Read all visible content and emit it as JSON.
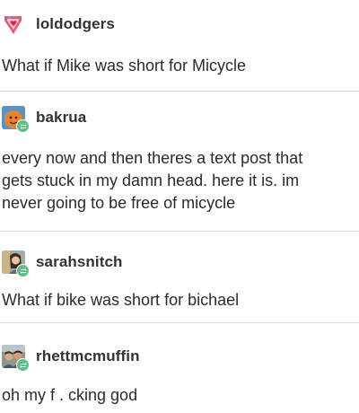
{
  "posts": [
    {
      "username": "loldodgers",
      "lines": [
        "What if Mike was short for Micycle"
      ],
      "avatar_icon": "heart-pennant-icon",
      "reblog": false
    },
    {
      "username": "bakrua",
      "lines": [
        "every now and then theres a text post that",
        "gets stuck in my damn head. here it is. im",
        "never going to be free of micycle"
      ],
      "avatar_icon": "orange-character-icon",
      "reblog": true
    },
    {
      "username": "sarahsnitch",
      "lines": [
        "What if bike was short for bichael"
      ],
      "avatar_icon": "person-photo-icon",
      "reblog": true
    },
    {
      "username": "rhettmcmuffin",
      "lines": [
        "oh my f . cking god"
      ],
      "avatar_icon": "people-photo-icon",
      "reblog": true
    }
  ],
  "colors": {
    "text": "#2b2b2b",
    "username": "#333333",
    "divider": "#dcdcdc",
    "reblog_badge": "#5cbf86",
    "background": "#ffffff"
  }
}
